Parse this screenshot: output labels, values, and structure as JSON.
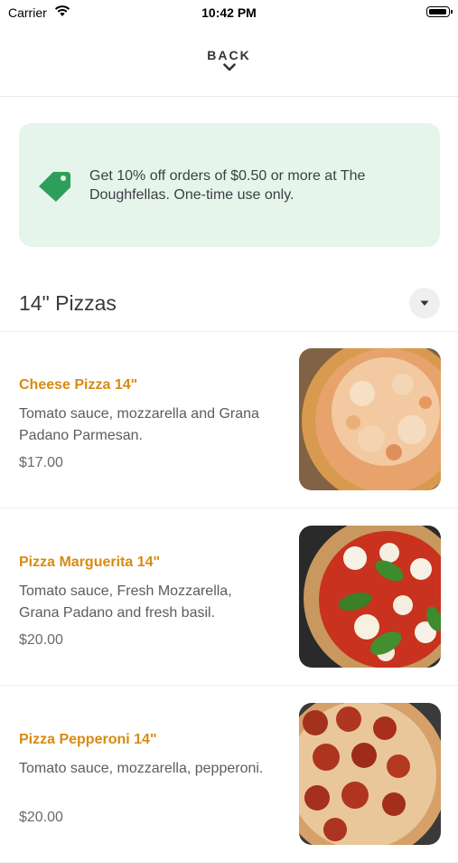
{
  "status_bar": {
    "carrier": "Carrier",
    "time": "10:42 PM"
  },
  "header": {
    "back_label": "BACK"
  },
  "promo": {
    "text": "Get 10% off orders of $0.50 or more at The Doughfellas. One-time use only.",
    "icon": "tag-icon",
    "accent": "#2e9e5b",
    "background": "#e6f5ec"
  },
  "section": {
    "title": "14\" Pizzas",
    "toggle_icon": "caret-down-icon"
  },
  "colors": {
    "item_name": "#d88a12",
    "text": "#5c5c5c"
  },
  "items": [
    {
      "name": "Cheese Pizza 14\"",
      "description": "Tomato sauce, mozzarella and Grana Padano Parmesan.",
      "price": "$17.00",
      "image": "cheese-pizza-photo"
    },
    {
      "name": "Pizza Marguerita 14\"",
      "description": "Tomato sauce, Fresh Mozzarella, Grana Padano and fresh basil.",
      "price": "$20.00",
      "image": "margherita-pizza-photo"
    },
    {
      "name": "Pizza Pepperoni 14\"",
      "description": "Tomato sauce, mozzarella, pepperoni.",
      "price": "$20.00",
      "image": "pepperoni-pizza-photo"
    }
  ]
}
